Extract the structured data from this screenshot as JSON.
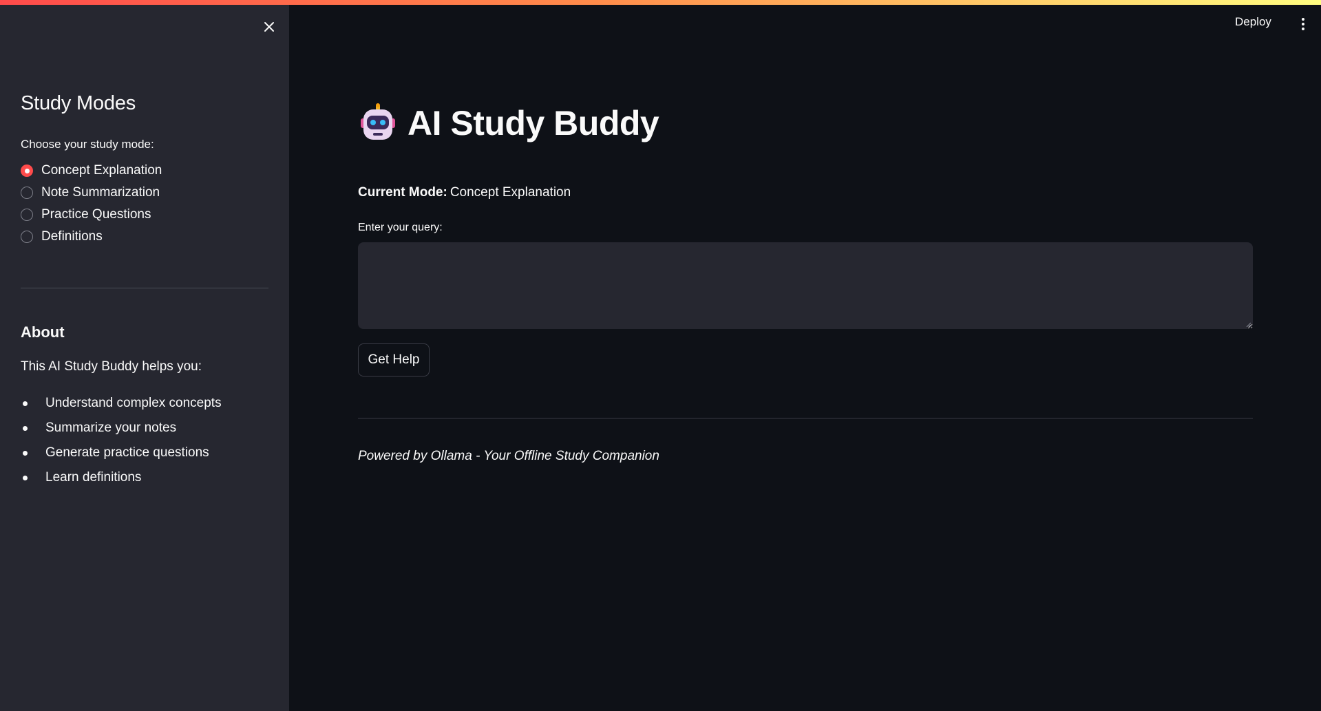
{
  "header": {
    "deploy_label": "Deploy",
    "menu_icon": "more-vert-icon"
  },
  "sidebar": {
    "close_icon": "close-icon",
    "title": "Study Modes",
    "mode_prompt": "Choose your study mode:",
    "modes": [
      {
        "label": "Concept Explanation",
        "selected": true
      },
      {
        "label": "Note Summarization",
        "selected": false
      },
      {
        "label": "Practice Questions",
        "selected": false
      },
      {
        "label": "Definitions",
        "selected": false
      }
    ],
    "about_heading": "About",
    "about_text": "This AI Study Buddy helps you:",
    "about_items": [
      "Understand complex concepts",
      "Summarize your notes",
      "Generate practice questions",
      "Learn definitions"
    ]
  },
  "main": {
    "title_icon": "robot-icon",
    "title": "AI Study Buddy",
    "current_mode_label": "Current Mode:",
    "current_mode_value": "Concept Explanation",
    "query_label": "Enter your query:",
    "query_value": "",
    "button_label": "Get Help",
    "footer": "Powered by Ollama - Your Offline Study Companion"
  },
  "colors": {
    "accent": "#ff4b4b",
    "background": "#0e1117",
    "sidebar": "#262730",
    "text": "#fafafa"
  }
}
